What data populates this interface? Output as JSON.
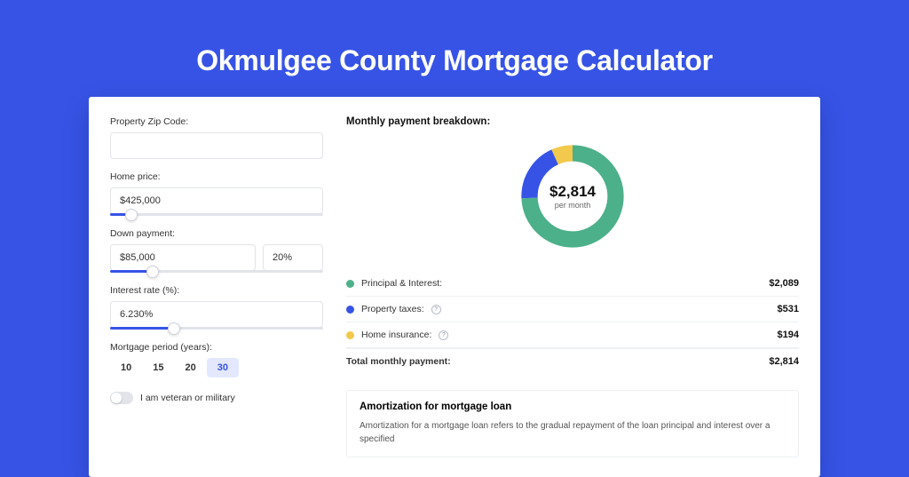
{
  "title": "Okmulgee County Mortgage Calculator",
  "colors": {
    "principal": "#4cb08a",
    "taxes": "#3653e6",
    "insurance": "#f2c94c"
  },
  "form": {
    "zip": {
      "label": "Property Zip Code:",
      "value": ""
    },
    "home_price": {
      "label": "Home price:",
      "value": "$425,000",
      "slider_pct": 10
    },
    "down_payment": {
      "label": "Down payment:",
      "value": "$85,000",
      "pct": "20%",
      "slider_pct": 20
    },
    "interest": {
      "label": "Interest rate (%):",
      "value": "6.230%",
      "slider_pct": 30
    },
    "period": {
      "label": "Mortgage period (years):",
      "options": [
        "10",
        "15",
        "20",
        "30"
      ],
      "active": "30"
    },
    "veteran": {
      "label": "I am veteran or military",
      "on": false
    }
  },
  "breakdown": {
    "title": "Monthly payment breakdown:",
    "center_value": "$2,814",
    "center_sub": "per month",
    "items": [
      {
        "label": "Principal & Interest:",
        "value": "$2,089",
        "color": "#4cb08a",
        "info": false
      },
      {
        "label": "Property taxes:",
        "value": "$531",
        "color": "#3653e6",
        "info": true
      },
      {
        "label": "Home insurance:",
        "value": "$194",
        "color": "#f2c94c",
        "info": true
      }
    ],
    "total": {
      "label": "Total monthly payment:",
      "value": "$2,814"
    }
  },
  "chart_data": {
    "type": "pie",
    "title": "Monthly payment breakdown",
    "unit": "USD",
    "series": [
      {
        "name": "Principal & Interest",
        "value": 2089,
        "color": "#4cb08a"
      },
      {
        "name": "Property taxes",
        "value": 531,
        "color": "#3653e6"
      },
      {
        "name": "Home insurance",
        "value": 194,
        "color": "#f2c94c"
      }
    ],
    "total": 2814
  },
  "amortization": {
    "title": "Amortization for mortgage loan",
    "text": "Amortization for a mortgage loan refers to the gradual repayment of the loan principal and interest over a specified"
  }
}
